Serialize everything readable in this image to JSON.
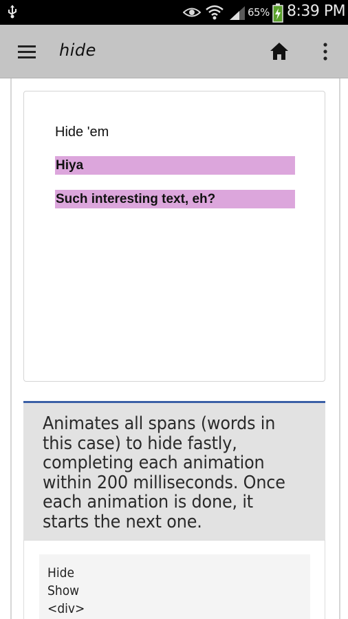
{
  "status_bar": {
    "battery_percent": "65%",
    "time": "8:39 PM",
    "icons": [
      "usb-icon",
      "eye-icon",
      "wifi-icon",
      "signal-icon",
      "battery-charging-icon"
    ]
  },
  "app_bar": {
    "title": "hide",
    "icons": [
      "menu-icon",
      "home-icon",
      "overflow-menu-icon"
    ]
  },
  "demo": {
    "heading": "Hide 'em",
    "spans": [
      "Hiya",
      "Such interesting text, eh?"
    ],
    "highlight_color": "#dca6dc"
  },
  "description": {
    "text": "Animates all spans (words in this case) to hide fastly, completing each animation within 200 milliseconds. Once each animation is done, it starts the next one.",
    "lines": [
      "Animates all spans (words in",
      "this case) to hide fastly,",
      "completing each animation",
      "within 200 milliseconds. Once",
      "each animation is done, it",
      "starts the next one."
    ],
    "accent_color": "#3a5fa6"
  },
  "code": {
    "lines": [
      "Hide",
      "Show",
      "<div>"
    ]
  }
}
